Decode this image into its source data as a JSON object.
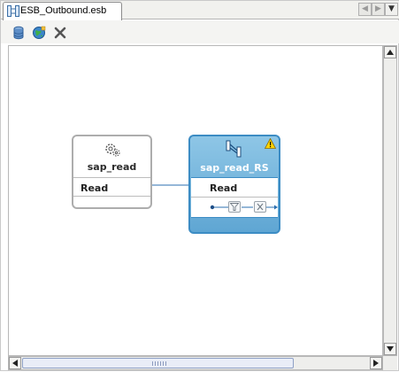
{
  "tab": {
    "label": "ESB_Outbound.esb"
  },
  "toolbar": {
    "icons": [
      "database-icon",
      "globe-icon",
      "delete-icon"
    ]
  },
  "diagram": {
    "source_node": {
      "title": "sap_read",
      "operation": "Read"
    },
    "target_node": {
      "title": "sap_read_RS",
      "operation": "Read",
      "warning": true
    },
    "colors": {
      "target_fill": "#7bb8df",
      "target_border": "#3c8cc4",
      "connector": "#2b6fb0",
      "source_border": "#adadad"
    }
  }
}
